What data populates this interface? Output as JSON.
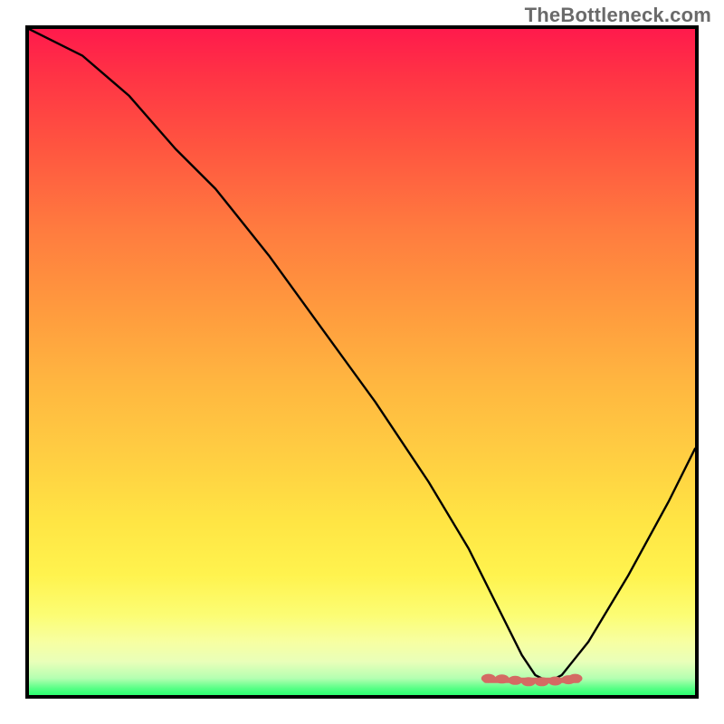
{
  "attribution": "TheBottleneck.com",
  "chart_data": {
    "type": "line",
    "title": "",
    "xlabel": "",
    "ylabel": "",
    "xlim": [
      0,
      100
    ],
    "ylim": [
      0,
      100
    ],
    "grid": false,
    "legend": false,
    "note": "Axes are unlabeled; values are normalized 0–100 from pixel positions. Curve depicts bottleneck % (high=bad red, low=good green) with minimum near x≈76.",
    "series": [
      {
        "name": "bottleneck-curve",
        "color": "#000000",
        "x": [
          0,
          8,
          15,
          22,
          28,
          36,
          44,
          52,
          60,
          66,
          70,
          74,
          76,
          78,
          80,
          84,
          90,
          96,
          100
        ],
        "values": [
          100,
          96,
          90,
          82,
          76,
          66,
          55,
          44,
          32,
          22,
          14,
          6,
          3,
          2,
          3,
          8,
          18,
          29,
          37
        ]
      }
    ],
    "markers": {
      "name": "optimal-region",
      "color": "#d46a63",
      "shape": "ellipse-dots",
      "x": [
        69,
        71,
        73,
        75,
        77,
        79,
        81,
        82
      ],
      "values": [
        2.5,
        2.4,
        2.2,
        2.0,
        2.0,
        2.1,
        2.3,
        2.5
      ]
    },
    "gradient": {
      "direction": "vertical",
      "stops": [
        {
          "pos": 0,
          "color": "#ff1a4c"
        },
        {
          "pos": 0.5,
          "color": "#ffb640"
        },
        {
          "pos": 0.85,
          "color": "#fff34e"
        },
        {
          "pos": 1.0,
          "color": "#2bff6f"
        }
      ]
    }
  }
}
